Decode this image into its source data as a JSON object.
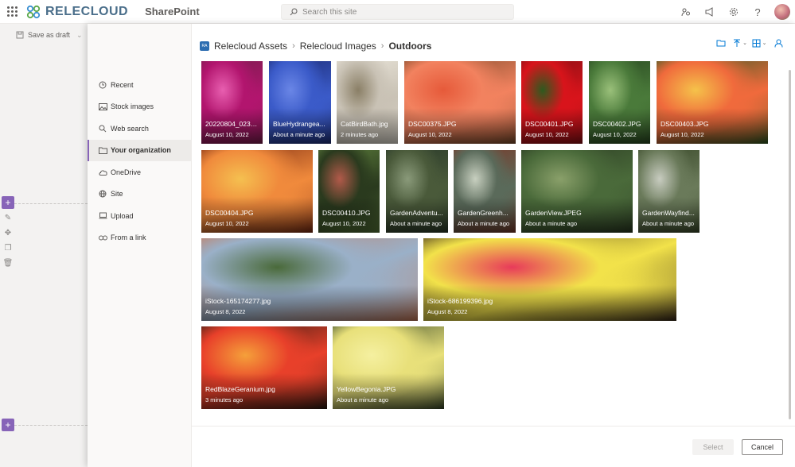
{
  "suitebar": {
    "brand": "RELECLOUD",
    "product": "SharePoint",
    "search_placeholder": "Search this site",
    "icons": [
      "app-launcher-icon",
      "share-icon",
      "megaphone-icon",
      "settings-icon",
      "help-icon",
      "avatar"
    ]
  },
  "page": {
    "save_draft": "Save as draft"
  },
  "picker": {
    "nav": [
      {
        "label": "Recent",
        "icon": "clock-icon"
      },
      {
        "label": "Stock images",
        "icon": "image-icon"
      },
      {
        "label": "Web search",
        "icon": "search-icon"
      },
      {
        "label": "Your organization",
        "icon": "folder-icon"
      },
      {
        "label": "OneDrive",
        "icon": "cloud-icon"
      },
      {
        "label": "Site",
        "icon": "globe-icon"
      },
      {
        "label": "Upload",
        "icon": "laptop-icon"
      },
      {
        "label": "From a link",
        "icon": "link-icon"
      }
    ],
    "selected_nav": "Your organization",
    "breadcrumb": {
      "site_badge": "RA",
      "items": [
        "Relecloud Assets",
        "Relecloud Images",
        "Outdoors"
      ]
    },
    "toolbar_icons": [
      "new-folder-icon",
      "upload-icon",
      "view-icon",
      "person-icon"
    ],
    "files": [
      {
        "name": "20220804_0232...",
        "date": "August 10, 2022",
        "colors": [
          "#b2156e",
          "#e85fb0",
          "#7a1d4e"
        ]
      },
      {
        "name": "BlueHydrangea...",
        "date": "About a minute ago",
        "colors": [
          "#3b5bc9",
          "#6a86e6",
          "#1e2f7a"
        ]
      },
      {
        "name": "CatBirdBath.jpg",
        "date": "2 minutes ago",
        "colors": [
          "#c9c2b5",
          "#8a7f66",
          "#e8e3d8"
        ]
      },
      {
        "name": "DSC00375.JPG",
        "date": "August 10, 2022",
        "colors": [
          "#f2825f",
          "#e65a3a",
          "#7a4a2a"
        ]
      },
      {
        "name": "DSC00401.JPG",
        "date": "August 10, 2022",
        "colors": [
          "#d8141b",
          "#2d5a1e",
          "#8a0f14"
        ]
      },
      {
        "name": "DSC00402.JPG",
        "date": "August 10, 2022",
        "colors": [
          "#4a7a3a",
          "#9ac07a",
          "#2a4a22"
        ]
      },
      {
        "name": "DSC00403.JPG",
        "date": "August 10, 2022",
        "colors": [
          "#f06a3c",
          "#f5c24a",
          "#2f5a22"
        ]
      },
      {
        "name": "DSC00404.JPG",
        "date": "August 10, 2022",
        "colors": [
          "#f08a3c",
          "#f5c050",
          "#7a2a12"
        ]
      },
      {
        "name": "DSC00410.JPG",
        "date": "August 10, 2022",
        "colors": [
          "#2a3a1e",
          "#b25a4a",
          "#5a7a3a"
        ]
      },
      {
        "name": "GardenAdventu...",
        "date": "About a minute ago",
        "colors": [
          "#4a5a3a",
          "#8a9a7a",
          "#2a3a2a"
        ]
      },
      {
        "name": "GardenGreenh...",
        "date": "About a minute ago",
        "colors": [
          "#5a6a5a",
          "#c8d0c0",
          "#7a3a2a"
        ]
      },
      {
        "name": "GardenView.JPEG",
        "date": "About a minute ago",
        "colors": [
          "#4a6a3a",
          "#8aa06a",
          "#2a3a22"
        ]
      },
      {
        "name": "GardenWayfind...",
        "date": "About a minute ago",
        "colors": [
          "#6a7a5a",
          "#c8ccc0",
          "#3a4a2a"
        ]
      },
      {
        "name": "iStock-165174277.jpg",
        "date": "August 8, 2022",
        "colors": [
          "#9ab0c8",
          "#4a6a3a",
          "#c87a5a"
        ]
      },
      {
        "name": "iStock-686199396.jpg",
        "date": "August 8, 2022",
        "colors": [
          "#f2e24a",
          "#e83a5a",
          "#3a2a1a"
        ]
      },
      {
        "name": "RedBlazeGeranium.jpg",
        "date": "3 minutes ago",
        "colors": [
          "#e8402a",
          "#f5a03a",
          "#2a1a12"
        ]
      },
      {
        "name": "YellowBegonia.JPG",
        "date": "About a minute ago",
        "colors": [
          "#e8e07a",
          "#f5f0a0",
          "#3a4a2a"
        ]
      }
    ],
    "buttons": {
      "select": "Select",
      "cancel": "Cancel"
    }
  }
}
